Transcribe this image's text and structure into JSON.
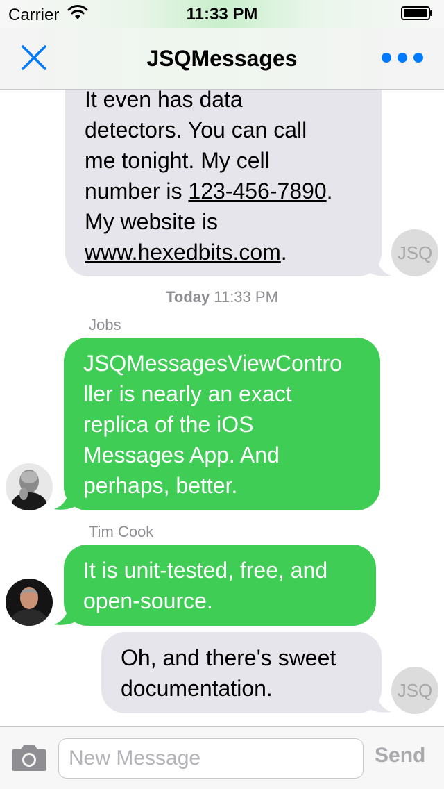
{
  "status_bar": {
    "carrier": "Carrier",
    "time": "11:33 PM"
  },
  "nav": {
    "title": "JSQMessages",
    "left_icon": "close-icon",
    "right_icon": "more-icon"
  },
  "messages": [
    {
      "direction": "incoming",
      "avatar_initials": "JSQ",
      "lines": [
        "It even has data",
        "detectors. You can call",
        "me tonight. My cell"
      ],
      "phone_prefix": "number is ",
      "phone": "123-456-7890",
      "phone_suffix": ".",
      "website_prefix": "My website is",
      "website": "www.hexedbits.com",
      "website_suffix": "."
    },
    {
      "direction": "outgoing",
      "sender": "Jobs",
      "timestamp_day": "Today",
      "timestamp_time": "11:33 PM",
      "lines": [
        "JSQMessagesViewContro",
        "ller is nearly an exact",
        "replica of the iOS",
        "Messages App. And",
        "perhaps, better."
      ]
    },
    {
      "direction": "outgoing",
      "sender": "Tim Cook",
      "lines": [
        "It is unit-tested, free, and",
        "open-source."
      ]
    },
    {
      "direction": "incoming",
      "avatar_initials": "JSQ",
      "lines": [
        "Oh, and there's sweet",
        "documentation."
      ]
    }
  ],
  "toolbar": {
    "placeholder": "New Message",
    "send_label": "Send",
    "left_icon": "camera-icon"
  },
  "colors": {
    "outgoing_bubble": "#3fcd55",
    "incoming_bubble": "#e6e5eb",
    "accent": "#007aff"
  }
}
